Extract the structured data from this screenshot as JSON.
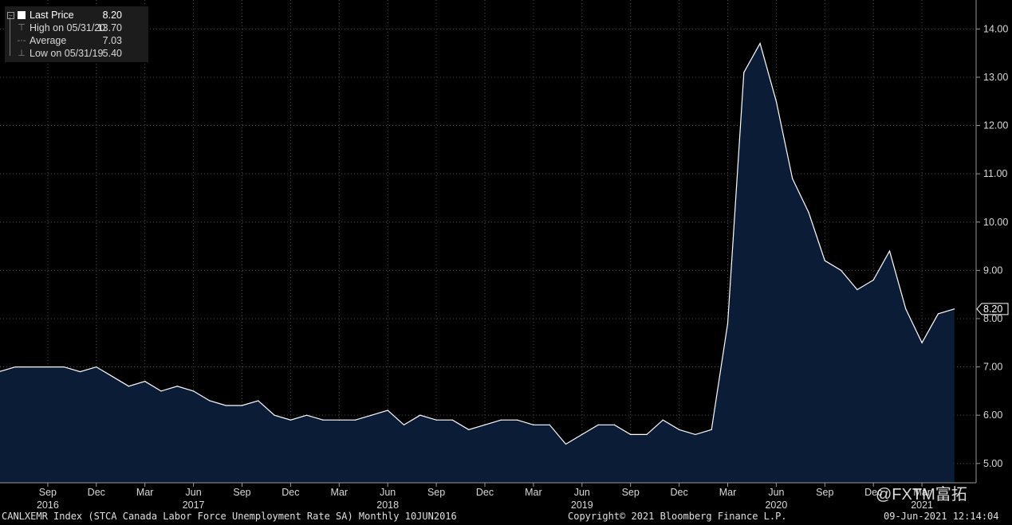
{
  "legend": {
    "last_price": {
      "label": "Last Price",
      "value": "8.20"
    },
    "high": {
      "label": "High on 05/31/20",
      "value": "13.70"
    },
    "average": {
      "label": "Average",
      "value": "7.03"
    },
    "low": {
      "label": "Low on 05/31/19",
      "value": "5.40"
    }
  },
  "footer": {
    "left": "CANLXEMR Index (STCA Canada Labor Force Unemployment Rate SA)  Monthly 10JUN2016",
    "center": "Copyright© 2021 Bloomberg Finance L.P.",
    "right": "09-Jun-2021 12:14:04"
  },
  "watermark": "@FXTM富拓",
  "colors": {
    "background": "#000000",
    "line": "#ffffff",
    "fill": "#0b1c36",
    "grid": "#4a4a4a"
  },
  "chart_data": {
    "type": "area",
    "y_ticks": [
      "5.00",
      "6.00",
      "7.00",
      "8.00",
      "9.00",
      "10.00",
      "11.00",
      "12.00",
      "13.00",
      "14.00"
    ],
    "ylim": [
      4.6,
      14.6
    ],
    "last_value_label": "8.20",
    "x_month_ticks": [
      {
        "label": "Sep",
        "date": "2016-09"
      },
      {
        "label": "Dec",
        "date": "2016-12"
      },
      {
        "label": "Mar",
        "date": "2017-03"
      },
      {
        "label": "Jun",
        "date": "2017-06"
      },
      {
        "label": "Sep",
        "date": "2017-09"
      },
      {
        "label": "Dec",
        "date": "2017-12"
      },
      {
        "label": "Mar",
        "date": "2018-03"
      },
      {
        "label": "Jun",
        "date": "2018-06"
      },
      {
        "label": "Sep",
        "date": "2018-09"
      },
      {
        "label": "Dec",
        "date": "2018-12"
      },
      {
        "label": "Mar",
        "date": "2019-03"
      },
      {
        "label": "Jun",
        "date": "2019-06"
      },
      {
        "label": "Sep",
        "date": "2019-09"
      },
      {
        "label": "Dec",
        "date": "2019-12"
      },
      {
        "label": "Mar",
        "date": "2020-03"
      },
      {
        "label": "Jun",
        "date": "2020-06"
      },
      {
        "label": "Sep",
        "date": "2020-09"
      },
      {
        "label": "Dec",
        "date": "2020-12"
      },
      {
        "label": "Mar",
        "date": "2021-03"
      }
    ],
    "x_year_ticks": [
      {
        "label": "2016",
        "date": "2016-09"
      },
      {
        "label": "2017",
        "date": "2017-06"
      },
      {
        "label": "2018",
        "date": "2018-06"
      },
      {
        "label": "2019",
        "date": "2019-06"
      },
      {
        "label": "2020",
        "date": "2020-06"
      },
      {
        "label": "2021",
        "date": "2021-03"
      }
    ],
    "series": [
      {
        "x": [
          "2016-06",
          "2016-07",
          "2016-08",
          "2016-09",
          "2016-10",
          "2016-11",
          "2016-12",
          "2017-01",
          "2017-02",
          "2017-03",
          "2017-04",
          "2017-05",
          "2017-06",
          "2017-07",
          "2017-08",
          "2017-09",
          "2017-10",
          "2017-11",
          "2017-12",
          "2018-01",
          "2018-02",
          "2018-03",
          "2018-04",
          "2018-05",
          "2018-06",
          "2018-07",
          "2018-08",
          "2018-09",
          "2018-10",
          "2018-11",
          "2018-12",
          "2019-01",
          "2019-02",
          "2019-03",
          "2019-04",
          "2019-05",
          "2019-06",
          "2019-07",
          "2019-08",
          "2019-09",
          "2019-10",
          "2019-11",
          "2019-12",
          "2020-01",
          "2020-02",
          "2020-03",
          "2020-04",
          "2020-05",
          "2020-06",
          "2020-07",
          "2020-08",
          "2020-09",
          "2020-10",
          "2020-11",
          "2020-12",
          "2021-01",
          "2021-02",
          "2021-03",
          "2021-04",
          "2021-05"
        ],
        "values": [
          6.9,
          7.0,
          7.0,
          7.0,
          7.0,
          6.9,
          7.0,
          6.8,
          6.6,
          6.7,
          6.5,
          6.6,
          6.5,
          6.3,
          6.2,
          6.2,
          6.3,
          6.0,
          5.9,
          6.0,
          5.9,
          5.9,
          5.9,
          6.0,
          6.1,
          5.8,
          6.0,
          5.9,
          5.9,
          5.7,
          5.8,
          5.9,
          5.9,
          5.8,
          5.8,
          5.4,
          5.6,
          5.8,
          5.8,
          5.6,
          5.6,
          5.9,
          5.7,
          5.6,
          5.7,
          7.9,
          13.1,
          13.7,
          12.5,
          10.9,
          10.2,
          9.2,
          9.0,
          8.6,
          8.8,
          9.4,
          8.2,
          7.5,
          8.1,
          8.2
        ]
      }
    ]
  }
}
